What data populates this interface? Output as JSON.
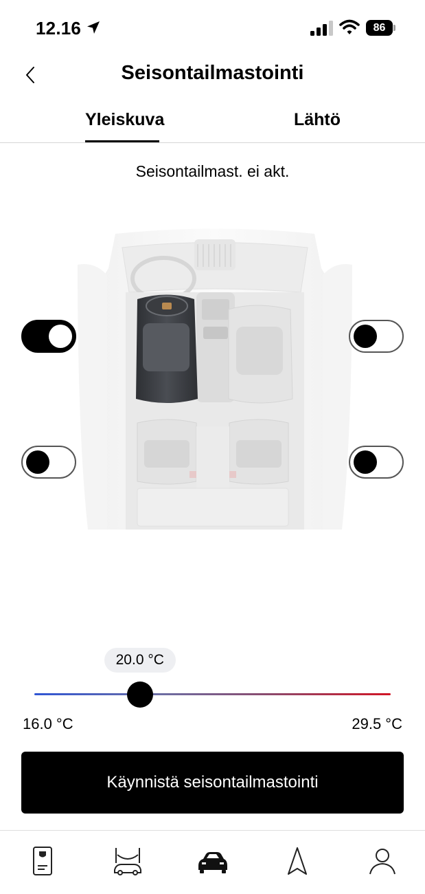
{
  "status_bar": {
    "time": "12.16",
    "battery": "86"
  },
  "header": {
    "title": "Seisontailmastointi"
  },
  "tabs": [
    {
      "label": "Yleiskuva",
      "active": true
    },
    {
      "label": "Lähtö",
      "active": false
    }
  ],
  "climate_status": "Seisontailmast. ei akt.",
  "seats": {
    "front_left": {
      "on": true
    },
    "front_right": {
      "on": false
    },
    "rear_left": {
      "on": false
    },
    "rear_right": {
      "on": false
    }
  },
  "temperature": {
    "value_label": "20.0 °C",
    "value": 20.0,
    "min_label": "16.0 °C",
    "max_label": "29.5 °C",
    "min": 16.0,
    "max": 29.5
  },
  "start_button_label": "Käynnistä seisontailmastointi",
  "bottom_nav": [
    {
      "icon": "vehicle-document-icon",
      "active": false
    },
    {
      "icon": "car-lift-icon",
      "active": false
    },
    {
      "icon": "car-icon",
      "active": true
    },
    {
      "icon": "navigation-icon",
      "active": false
    },
    {
      "icon": "profile-icon",
      "active": false
    }
  ],
  "colors": {
    "accent": "#000000",
    "track_cold": "#2f55d4",
    "track_hot": "#d11525",
    "bubble": "#eeeff2"
  }
}
